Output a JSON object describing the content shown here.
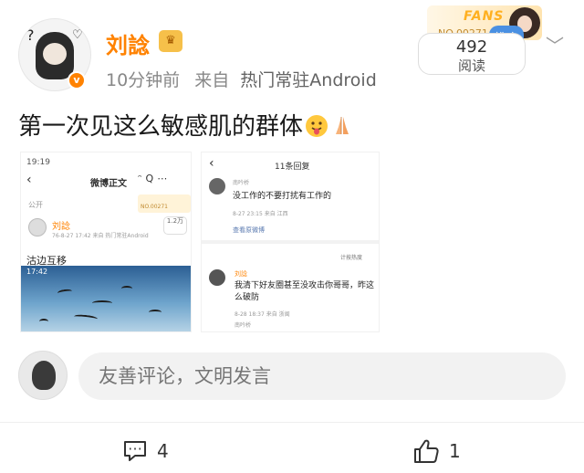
{
  "header": {
    "username": "刘諗",
    "time": "10分钟前",
    "source_prefix": "来自",
    "source": "热门常驻Android",
    "fans_card": {
      "label": "FANS",
      "number": "NO.00271"
    },
    "promo_tag": "推广",
    "read_count": "492",
    "read_label": "阅读"
  },
  "post": {
    "text": "第一次见这么敏感肌的群体"
  },
  "screenshot1": {
    "status_time": "19:19",
    "title": "微博正文",
    "visibility": "公开",
    "fans_no": "NO.00271",
    "author": "刘諗",
    "meta": "76-8-27 17:42 来自 热门常驻Android",
    "read_count": "1.2万",
    "post_text": "沽边互移",
    "image_status": "17:42"
  },
  "screenshot2": {
    "title": "11条回复",
    "reply1_user": "南吟桥",
    "reply1_text": "没工作的不要打扰有工作的",
    "reply1_meta": "8-27 23:15 来自 江西",
    "view_original": "查看原微博",
    "sort_label": "计按热度",
    "reply2_user": "刘諗",
    "reply2_text": "我清下好友圈甚至没攻击你哥哥，昨这么破防",
    "reply2_meta": "8-28 18:37 来自 浙闽",
    "sub_reply_user": "南吟桥"
  },
  "comment_bar": {
    "placeholder": "友善评论，文明发言"
  },
  "actions": {
    "comment_count": "4",
    "like_count": "1"
  }
}
